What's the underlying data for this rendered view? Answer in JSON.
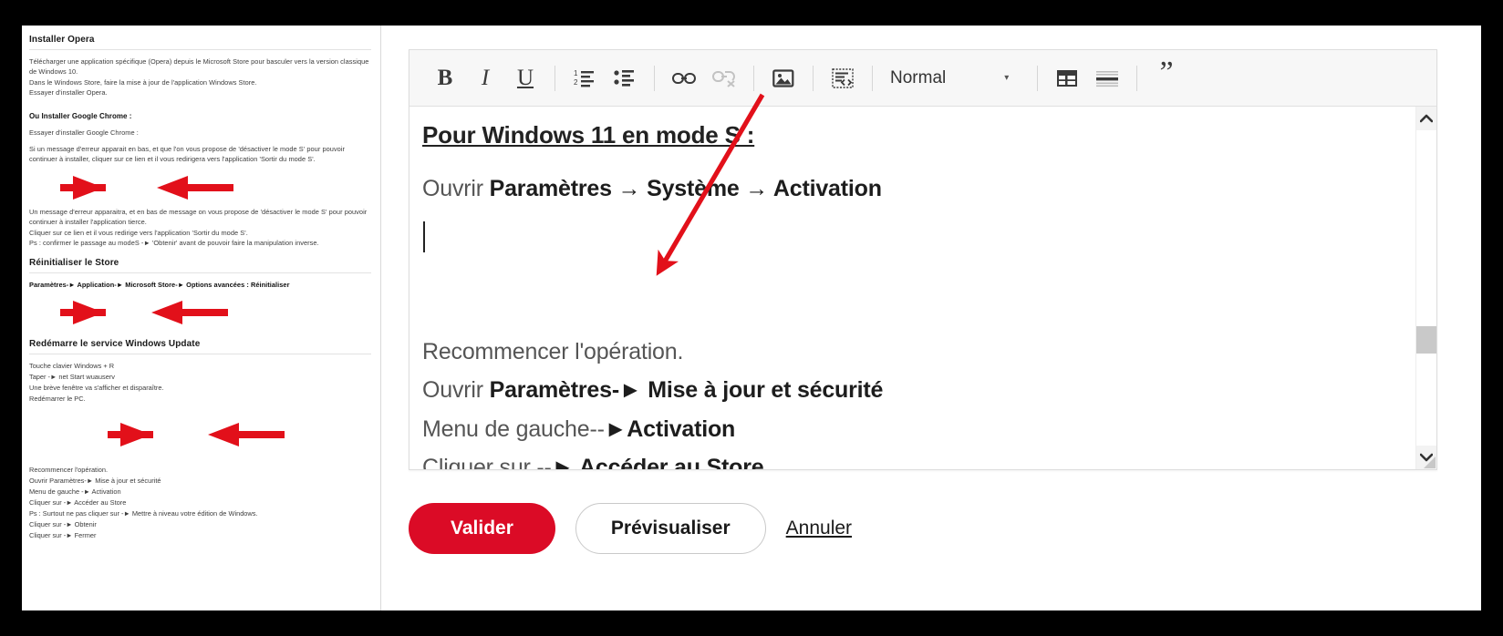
{
  "left_document": {
    "sections": [
      {
        "heading": "Installer Opera",
        "paragraphs": [
          "Télécharger une application spécifique (Opera) depuis le Microsoft Store pour basculer vers la version classique de Windows 10.",
          "Dans le Windows Store, faire la mise à jour de l'application Windows Store.",
          "Essayer d'installer Opera."
        ]
      },
      {
        "heading": "Ou Installer Google Chrome :",
        "paragraphs": [
          "Essayer d'installer Google Chrome :",
          "Si un message d'erreur apparait en bas, et que l'on vous propose de 'désactiver le mode S' pour pouvoir continuer à installer, cliquer sur ce lien et il vous redirigera vers l'application 'Sortir du mode S'."
        ]
      },
      {
        "heading": "",
        "paragraphs": [
          "Un message d'erreur apparaitra, et en bas de message on vous propose de 'désactiver le mode S' pour pouvoir continuer à installer l'application tierce.",
          "Cliquer sur ce lien et il vous redirige vers l'application 'Sortir du mode S'.",
          "Ps : confirmer le passage au modeS -► 'Obtenir' avant de pouvoir faire la manipulation inverse."
        ]
      },
      {
        "heading": "Réinitialiser le Store",
        "paragraphs": [
          "Paramètres-► Application-► Microsoft Store-► Options avancées : Réinitialiser"
        ]
      },
      {
        "heading": "Redémarre le service Windows Update",
        "paragraphs": [
          "Touche clavier Windows + R",
          "Taper -► net Start wuauserv",
          "Une brève fenêtre va s'afficher et disparaître.",
          "Redémarrer le PC."
        ]
      },
      {
        "heading": "",
        "paragraphs": [
          "Recommencer l'opération.",
          "Ouvrir Paramètres-► Mise à jour et sécurité",
          "Menu de gauche -► Activation",
          "Cliquer sur -► Accéder au Store",
          "Ps : Surtout ne pas cliquer sur -► Mettre à niveau votre édition de Windows.",
          "Cliquer sur -► Obtenir",
          "Cliquer sur -► Fermer"
        ]
      }
    ],
    "bold_fragments": [
      "Installer Google Chrome",
      "désactiver le mode S",
      "Sortir du mode S",
      "Obtenir",
      "Windows + R",
      "net Start wuauserv",
      "Paramètres-► Mise à jour et sécurité",
      "Activation",
      "Accéder au Store",
      "Mettre à niveau votre édition de Windows.",
      "Fermer"
    ]
  },
  "editor": {
    "toolbar": {
      "bold": "B",
      "italic": "I",
      "underline": "U",
      "ordered_list_icon": "ordered-list-icon",
      "bullet_list_icon": "bullet-list-icon",
      "link_icon": "link-icon",
      "unlink_icon": "unlink-icon",
      "image_icon": "image-icon",
      "source_code_icon": "source-code-icon",
      "style_value": "Normal",
      "style_caret": "▾",
      "table_icon": "table-icon",
      "horizontal_rule_icon": "horizontal-rule-icon",
      "blockquote": "”"
    },
    "content": {
      "title": "Pour Windows 11 en mode S :",
      "line_open": "Ouvrir ",
      "line_open_bold": "Paramètres → Système → Activation",
      "para_restart": "Recommencer l'opération.",
      "line_settings_prefix": "Ouvrir ",
      "line_settings_bold": "Paramètres-► Mise à jour et sécurité",
      "line_menu_prefix": "Menu de gauche--",
      "line_menu_bold": "►Activation",
      "line_click_prefix": "Cliquer sur --",
      "line_click_bold": "► Accéder au Store"
    },
    "scrollbar": {
      "up_arrow": "⌃",
      "down_arrow": "⌄"
    }
  },
  "actions": {
    "submit_label": "Valider",
    "preview_label": "Prévisualiser",
    "cancel_label": "Annuler"
  },
  "colors": {
    "accent_red": "#DB0B26",
    "annotation_red": "#E2101A",
    "toolbar_bg": "#F7F7F7",
    "text_dark": "#1D1D1D",
    "text_muted": "#555555"
  }
}
